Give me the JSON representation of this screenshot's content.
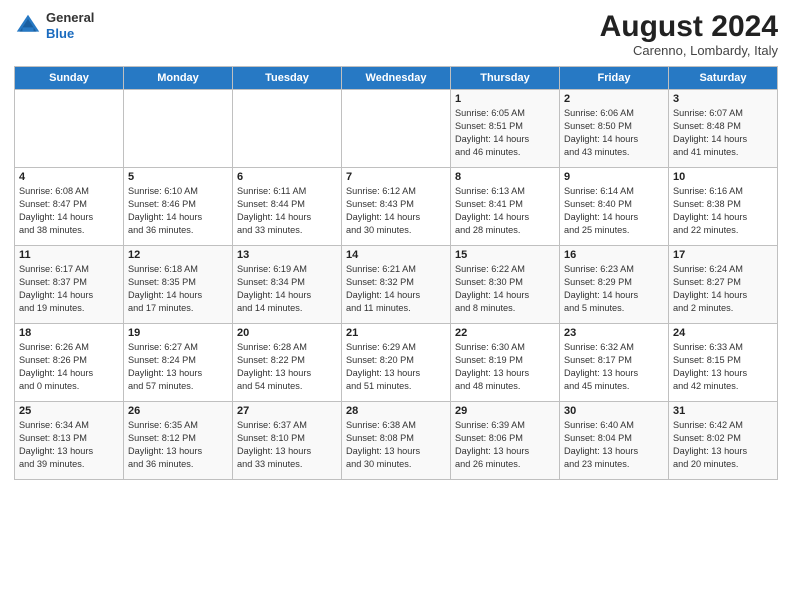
{
  "header": {
    "logo_line1": "General",
    "logo_line2": "Blue",
    "month_title": "August 2024",
    "subtitle": "Carenno, Lombardy, Italy"
  },
  "weekdays": [
    "Sunday",
    "Monday",
    "Tuesday",
    "Wednesday",
    "Thursday",
    "Friday",
    "Saturday"
  ],
  "weeks": [
    [
      {
        "day": "",
        "info": ""
      },
      {
        "day": "",
        "info": ""
      },
      {
        "day": "",
        "info": ""
      },
      {
        "day": "",
        "info": ""
      },
      {
        "day": "1",
        "info": "Sunrise: 6:05 AM\nSunset: 8:51 PM\nDaylight: 14 hours\nand 46 minutes."
      },
      {
        "day": "2",
        "info": "Sunrise: 6:06 AM\nSunset: 8:50 PM\nDaylight: 14 hours\nand 43 minutes."
      },
      {
        "day": "3",
        "info": "Sunrise: 6:07 AM\nSunset: 8:48 PM\nDaylight: 14 hours\nand 41 minutes."
      }
    ],
    [
      {
        "day": "4",
        "info": "Sunrise: 6:08 AM\nSunset: 8:47 PM\nDaylight: 14 hours\nand 38 minutes."
      },
      {
        "day": "5",
        "info": "Sunrise: 6:10 AM\nSunset: 8:46 PM\nDaylight: 14 hours\nand 36 minutes."
      },
      {
        "day": "6",
        "info": "Sunrise: 6:11 AM\nSunset: 8:44 PM\nDaylight: 14 hours\nand 33 minutes."
      },
      {
        "day": "7",
        "info": "Sunrise: 6:12 AM\nSunset: 8:43 PM\nDaylight: 14 hours\nand 30 minutes."
      },
      {
        "day": "8",
        "info": "Sunrise: 6:13 AM\nSunset: 8:41 PM\nDaylight: 14 hours\nand 28 minutes."
      },
      {
        "day": "9",
        "info": "Sunrise: 6:14 AM\nSunset: 8:40 PM\nDaylight: 14 hours\nand 25 minutes."
      },
      {
        "day": "10",
        "info": "Sunrise: 6:16 AM\nSunset: 8:38 PM\nDaylight: 14 hours\nand 22 minutes."
      }
    ],
    [
      {
        "day": "11",
        "info": "Sunrise: 6:17 AM\nSunset: 8:37 PM\nDaylight: 14 hours\nand 19 minutes."
      },
      {
        "day": "12",
        "info": "Sunrise: 6:18 AM\nSunset: 8:35 PM\nDaylight: 14 hours\nand 17 minutes."
      },
      {
        "day": "13",
        "info": "Sunrise: 6:19 AM\nSunset: 8:34 PM\nDaylight: 14 hours\nand 14 minutes."
      },
      {
        "day": "14",
        "info": "Sunrise: 6:21 AM\nSunset: 8:32 PM\nDaylight: 14 hours\nand 11 minutes."
      },
      {
        "day": "15",
        "info": "Sunrise: 6:22 AM\nSunset: 8:30 PM\nDaylight: 14 hours\nand 8 minutes."
      },
      {
        "day": "16",
        "info": "Sunrise: 6:23 AM\nSunset: 8:29 PM\nDaylight: 14 hours\nand 5 minutes."
      },
      {
        "day": "17",
        "info": "Sunrise: 6:24 AM\nSunset: 8:27 PM\nDaylight: 14 hours\nand 2 minutes."
      }
    ],
    [
      {
        "day": "18",
        "info": "Sunrise: 6:26 AM\nSunset: 8:26 PM\nDaylight: 14 hours\nand 0 minutes."
      },
      {
        "day": "19",
        "info": "Sunrise: 6:27 AM\nSunset: 8:24 PM\nDaylight: 13 hours\nand 57 minutes."
      },
      {
        "day": "20",
        "info": "Sunrise: 6:28 AM\nSunset: 8:22 PM\nDaylight: 13 hours\nand 54 minutes."
      },
      {
        "day": "21",
        "info": "Sunrise: 6:29 AM\nSunset: 8:20 PM\nDaylight: 13 hours\nand 51 minutes."
      },
      {
        "day": "22",
        "info": "Sunrise: 6:30 AM\nSunset: 8:19 PM\nDaylight: 13 hours\nand 48 minutes."
      },
      {
        "day": "23",
        "info": "Sunrise: 6:32 AM\nSunset: 8:17 PM\nDaylight: 13 hours\nand 45 minutes."
      },
      {
        "day": "24",
        "info": "Sunrise: 6:33 AM\nSunset: 8:15 PM\nDaylight: 13 hours\nand 42 minutes."
      }
    ],
    [
      {
        "day": "25",
        "info": "Sunrise: 6:34 AM\nSunset: 8:13 PM\nDaylight: 13 hours\nand 39 minutes."
      },
      {
        "day": "26",
        "info": "Sunrise: 6:35 AM\nSunset: 8:12 PM\nDaylight: 13 hours\nand 36 minutes."
      },
      {
        "day": "27",
        "info": "Sunrise: 6:37 AM\nSunset: 8:10 PM\nDaylight: 13 hours\nand 33 minutes."
      },
      {
        "day": "28",
        "info": "Sunrise: 6:38 AM\nSunset: 8:08 PM\nDaylight: 13 hours\nand 30 minutes."
      },
      {
        "day": "29",
        "info": "Sunrise: 6:39 AM\nSunset: 8:06 PM\nDaylight: 13 hours\nand 26 minutes."
      },
      {
        "day": "30",
        "info": "Sunrise: 6:40 AM\nSunset: 8:04 PM\nDaylight: 13 hours\nand 23 minutes."
      },
      {
        "day": "31",
        "info": "Sunrise: 6:42 AM\nSunset: 8:02 PM\nDaylight: 13 hours\nand 20 minutes."
      }
    ]
  ]
}
